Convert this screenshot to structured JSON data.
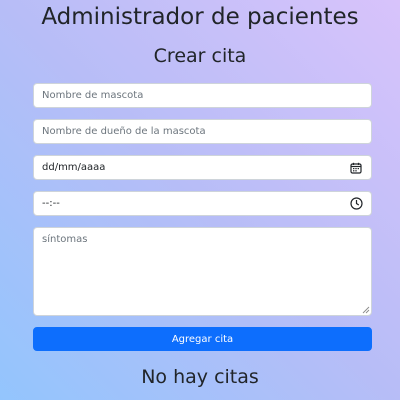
{
  "header": {
    "title": "Administrador de pacientes"
  },
  "form": {
    "title": "Crear cita",
    "pet_name_placeholder": "Nombre de mascota",
    "owner_name_placeholder": "Nombre de dueño de la mascota",
    "date_value": "dd/mm/aaaa",
    "date_icon": "calendar-icon",
    "time_value": "--:--",
    "time_icon": "clock-icon",
    "symptoms_placeholder": "síntomas",
    "submit_label": "Agregar cita"
  },
  "appointments": {
    "empty_message": "No hay citas"
  },
  "colors": {
    "accent": "#0d6efd",
    "text": "#212529"
  }
}
